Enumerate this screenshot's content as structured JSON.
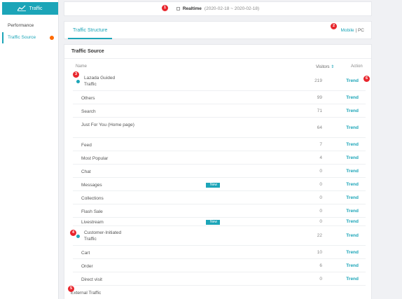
{
  "sidebar": {
    "header": "Traffic",
    "items": [
      {
        "label": "Performance"
      },
      {
        "label": "Traffic Source"
      }
    ]
  },
  "topbar": {
    "realtime_label": "Realtime",
    "date_range": "(2020-02-18 ~ 2020-02-18)"
  },
  "tabs": {
    "structure": "Traffic Structure",
    "mobile": "Mobile",
    "separator": "|",
    "pc": "PC"
  },
  "traffic_source": {
    "title": "Traffic Source",
    "columns": {
      "name": "Name",
      "visitors": "Visitors",
      "action": "Action"
    },
    "rows": [
      {
        "name": "Lazada Guided Traffic",
        "visitors": "219",
        "action": "Trend"
      },
      {
        "name": "Others",
        "visitors": "99",
        "action": "Trend"
      },
      {
        "name": "Search",
        "visitors": "71",
        "action": "Trend"
      },
      {
        "name": "Just For You (Home page)",
        "visitors": "64",
        "action": "Trend"
      },
      {
        "name": "Feed",
        "visitors": "7",
        "action": "Trend"
      },
      {
        "name": "Most Popular",
        "visitors": "4",
        "action": "Trend"
      },
      {
        "name": "Chat",
        "visitors": "0",
        "action": "Trend"
      },
      {
        "name": "Messages",
        "visitors": "0",
        "action": "Trend",
        "badge": "New"
      },
      {
        "name": "Collections",
        "visitors": "0",
        "action": "Trend"
      },
      {
        "name": "Flash Sale",
        "visitors": "0",
        "action": "Trend"
      },
      {
        "name": "Livestream",
        "visitors": "0",
        "action": "Trend",
        "badge": "New"
      },
      {
        "name": "Customer-Initiated Traffic",
        "visitors": "22",
        "action": "Trend"
      },
      {
        "name": "Cart",
        "visitors": "10",
        "action": "Trend"
      },
      {
        "name": "Order",
        "visitors": "6",
        "action": "Trend"
      },
      {
        "name": "Direct visit",
        "visitors": "0",
        "action": "Trend"
      },
      {
        "name": "External Traffic"
      }
    ]
  },
  "markers": [
    "1",
    "2",
    "3",
    "4",
    "5",
    "6"
  ],
  "colors": {
    "accent": "#1ca5b8",
    "marker": "#e8262d",
    "notify": "#ff6a00"
  }
}
